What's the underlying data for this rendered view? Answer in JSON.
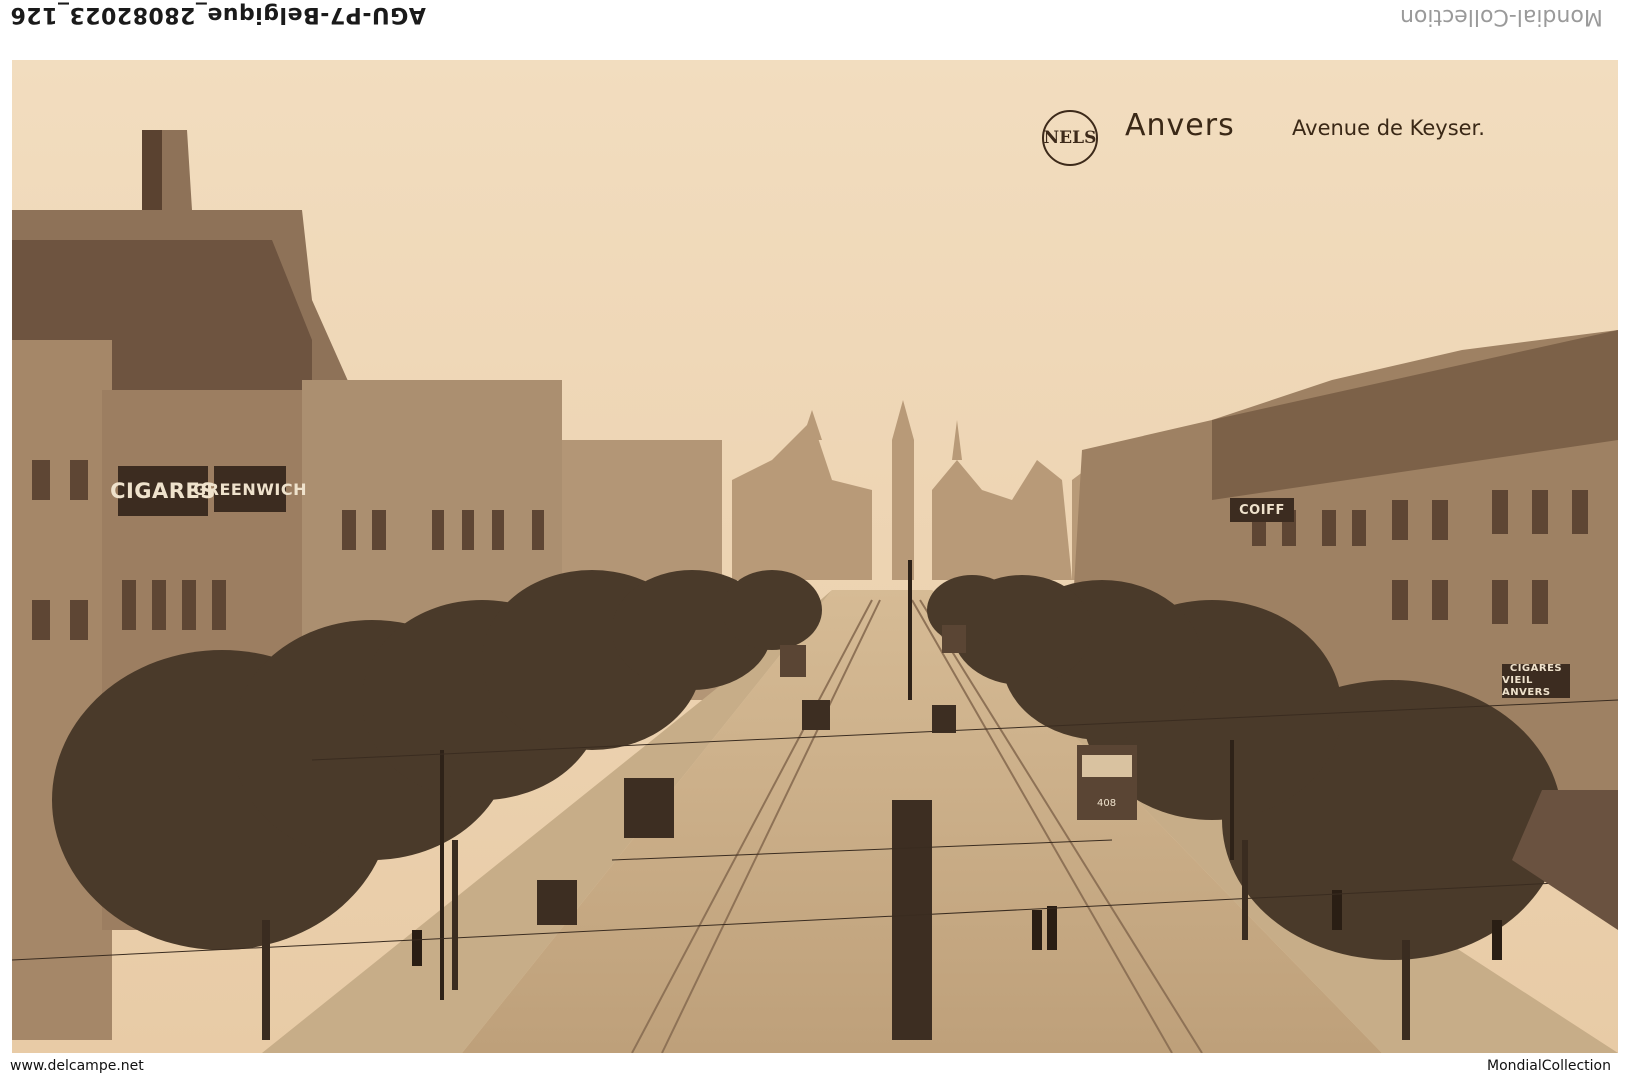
{
  "header": {
    "reference_code": "AGU-P7-Belgique_28082023_126",
    "brand": "Mondial-Collection"
  },
  "postcard": {
    "logo_text": "NELS",
    "city": "Anvers",
    "street": "Avenue de Keyser.",
    "signs": {
      "cigares_left": "CIGARES",
      "greenwich": "GREENWICH",
      "coiff": "COIFF",
      "cigares_right_line1": "CIGARES",
      "cigares_right_line2": "VIEIL ANVERS"
    },
    "tram_number": "408"
  },
  "footer": {
    "left": "www.delcampe.net",
    "right": "MondialCollection"
  },
  "colors": {
    "sepia_sky": "#efd7b6",
    "sepia_dark": "#3c2c20"
  }
}
